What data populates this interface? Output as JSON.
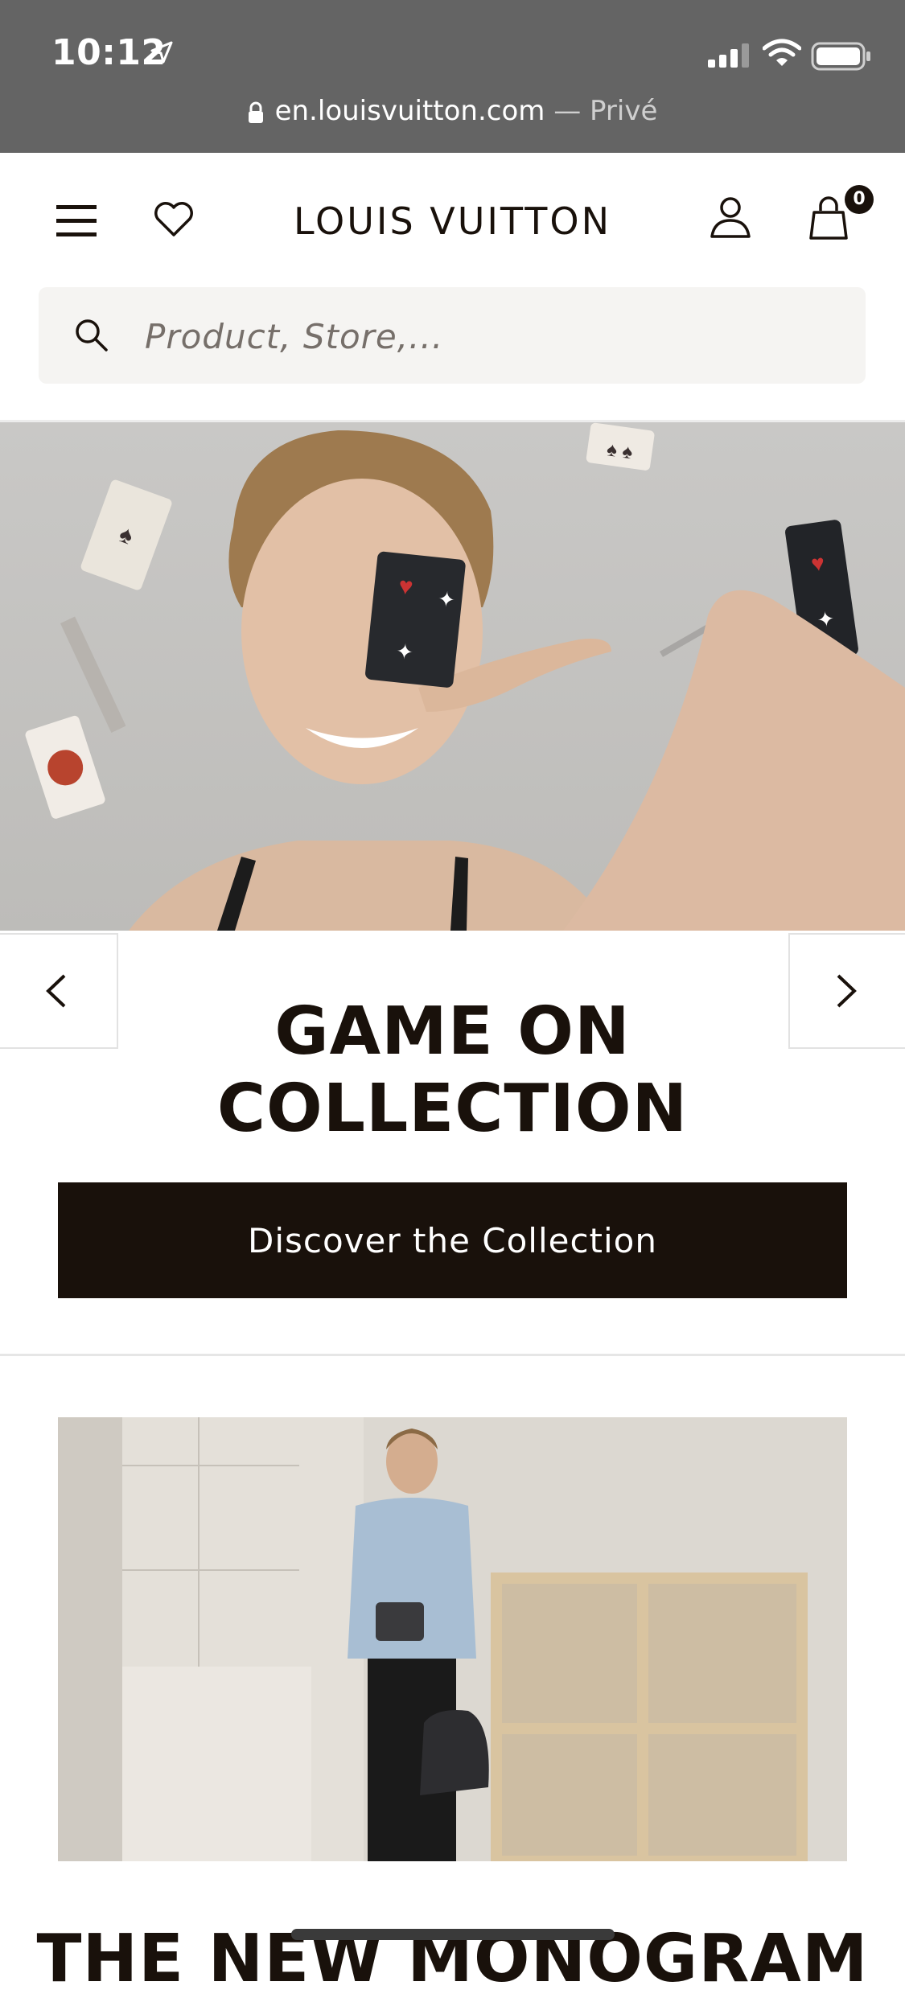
{
  "status_bar": {
    "time": "10:12"
  },
  "browser": {
    "domain": "en.louisvuitton.com",
    "mode": "— Privé"
  },
  "header": {
    "logo": "LOUIS VUITTON",
    "bag_count": "0"
  },
  "search": {
    "placeholder": "Product, Store,..."
  },
  "hero": {
    "title_line1": "GAME ON",
    "title_line2": "COLLECTION",
    "cta_label": "Discover the Collection"
  },
  "next_section": {
    "title": "THE NEW MONOGRAM"
  },
  "colors": {
    "brand_dark": "#19110b",
    "status_bar": "#646464",
    "search_bg": "#f5f4f2"
  }
}
